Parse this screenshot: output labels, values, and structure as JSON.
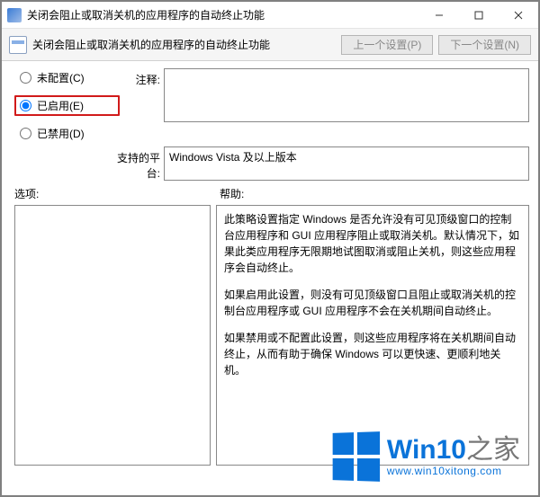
{
  "titlebar": {
    "title": "关闭会阻止或取消关机的应用程序的自动终止功能"
  },
  "header": {
    "policy_title": "关闭会阻止或取消关机的应用程序的自动终止功能",
    "prev_setting": "上一个设置(P)",
    "next_setting": "下一个设置(N)"
  },
  "radios": {
    "not_configured": "未配置(C)",
    "enabled": "已启用(E)",
    "disabled": "已禁用(D)",
    "selected": "enabled"
  },
  "labels": {
    "comment": "注释:",
    "supported": "支持的平台:",
    "options": "选项:",
    "help": "帮助:"
  },
  "fields": {
    "comment_value": "",
    "supported_value": "Windows Vista 及以上版本"
  },
  "help": {
    "p1": "此策略设置指定 Windows 是否允许没有可见顶级窗口的控制台应用程序和 GUI 应用程序阻止或取消关机。默认情况下，如果此类应用程序无限期地试图取消或阻止关机，则这些应用程序会自动终止。",
    "p2": "如果启用此设置，则没有可见顶级窗口且阻止或取消关机的控制台应用程序或 GUI 应用程序不会在关机期间自动终止。",
    "p3": "如果禁用或不配置此设置，则这些应用程序将在关机期间自动终止，从而有助于确保 Windows 可以更快速、更顺利地关机。"
  },
  "watermark": {
    "brand_a": "Win10",
    "brand_b": "之家",
    "url": "www.win10xitong.com"
  }
}
